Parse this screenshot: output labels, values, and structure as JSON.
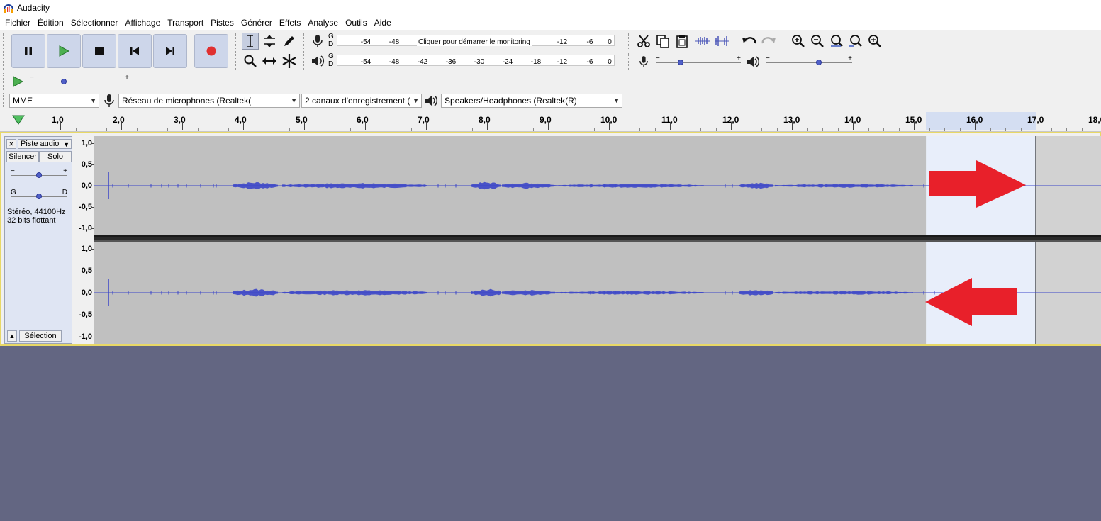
{
  "window": {
    "title": "Audacity"
  },
  "menu": [
    "Fichier",
    "Édition",
    "Sélectionner",
    "Affichage",
    "Transport",
    "Pistes",
    "Générer",
    "Effets",
    "Analyse",
    "Outils",
    "Aide"
  ],
  "transport": {
    "pause_icon": "pause-icon",
    "play_icon": "play-icon",
    "stop_icon": "stop-icon",
    "skip_start_icon": "skip-to-start-icon",
    "skip_end_icon": "skip-to-end-icon",
    "record_icon": "record-icon",
    "record_color": "#e03030",
    "play_color": "#3aa048"
  },
  "meters": {
    "record": {
      "left_label": "G",
      "right_label": "D",
      "ticks": [
        "-54",
        "-48",
        "-12",
        "-6",
        "0"
      ],
      "hint": "Cliquer pour démarrer le monitoring"
    },
    "playback": {
      "left_label": "G",
      "right_label": "D",
      "ticks": [
        "-54",
        "-48",
        "-42",
        "-36",
        "-30",
        "-24",
        "-18",
        "-12",
        "-6",
        "0"
      ]
    }
  },
  "mixer": {
    "minus": "−",
    "plus": "+"
  },
  "play_at_speed": {
    "minus": "−",
    "plus": "+"
  },
  "devices": {
    "host": "MME",
    "recording_device": "Réseau de microphones (Realtek(",
    "channels": "2 canaux d'enregistrement (",
    "playback_device": "Speakers/Headphones (Realtek(R)"
  },
  "ruler": {
    "labels": [
      "1,0",
      "2,0",
      "3,0",
      "4,0",
      "5,0",
      "6,0",
      "7,0",
      "8,0",
      "9,0",
      "10,0",
      "11,0",
      "12,0",
      "13,0",
      "14,0",
      "15,0",
      "16,0",
      "17,0",
      "18,0"
    ],
    "selection_start": 15.2,
    "selection_end": 17.0
  },
  "track": {
    "name": "Piste audio",
    "close": "×",
    "mute": "Silencer",
    "solo": "Solo",
    "gain_minus": "−",
    "gain_plus": "+",
    "pan_left": "G",
    "pan_right": "D",
    "format_line1": "Stéréo, 44100Hz",
    "format_line2": "32 bits flottant",
    "select_button": "Sélection",
    "collapse_icon": "▲",
    "vruler_labels": [
      "1,0",
      "0,5",
      "0,0",
      "-0,5",
      "-1,0"
    ],
    "wave_color": "#3c46c8",
    "bg_color": "#c0c0c0",
    "selection_color": "#e8eefa"
  },
  "annotations": {
    "arrow_color": "#e8202a"
  }
}
